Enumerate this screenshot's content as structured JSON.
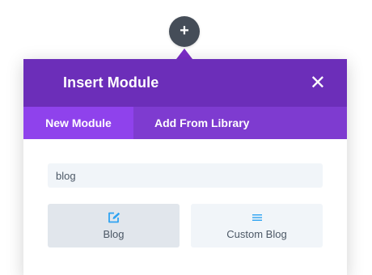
{
  "add_button": {
    "symbol": "+",
    "color": "#454d58"
  },
  "modal": {
    "title": "Insert Module",
    "close_symbol": "✕",
    "header_color": "#6c2eb9",
    "tabs": [
      {
        "label": "New Module",
        "active": true
      },
      {
        "label": "Add From Library",
        "active": false
      }
    ],
    "search": {
      "value": "blog",
      "placeholder": ""
    },
    "modules": [
      {
        "label": "Blog",
        "icon": "blog-edit-icon",
        "selected": true
      },
      {
        "label": "Custom Blog",
        "icon": "list-lines-icon",
        "selected": false
      }
    ]
  },
  "colors": {
    "accent": "#7e3bd0",
    "active_tab": "#8f42ec",
    "icon_blue": "#2ea3f2"
  }
}
